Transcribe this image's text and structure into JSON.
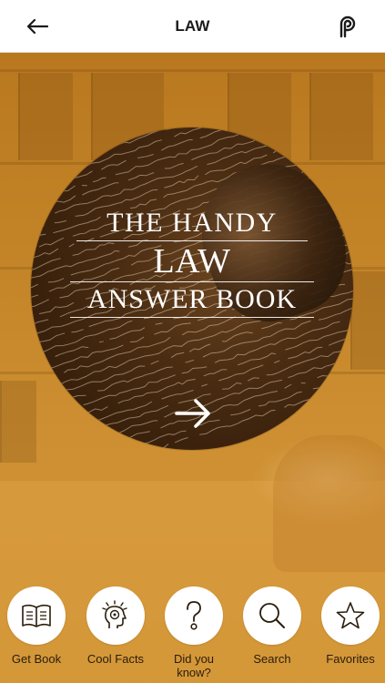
{
  "header": {
    "title": "LAW",
    "back_icon": "arrow-left-icon",
    "logo_icon": "app-logo-icon"
  },
  "book": {
    "title_line1": "THE HANDY",
    "title_line2": "LAW",
    "title_line3": "ANSWER BOOK",
    "open_icon": "arrow-right-icon"
  },
  "nav": {
    "items": [
      {
        "label": "Get Book",
        "icon": "book-icon"
      },
      {
        "label": "Cool Facts",
        "icon": "head-lightbulb-icon"
      },
      {
        "label": "Did you know?",
        "icon": "question-icon"
      },
      {
        "label": "Search",
        "icon": "search-icon"
      },
      {
        "label": "Favorites",
        "icon": "star-icon"
      }
    ]
  },
  "colors": {
    "accent": "#c8862a",
    "header_bg": "#ffffff",
    "text_dark": "#1a1a1a"
  }
}
